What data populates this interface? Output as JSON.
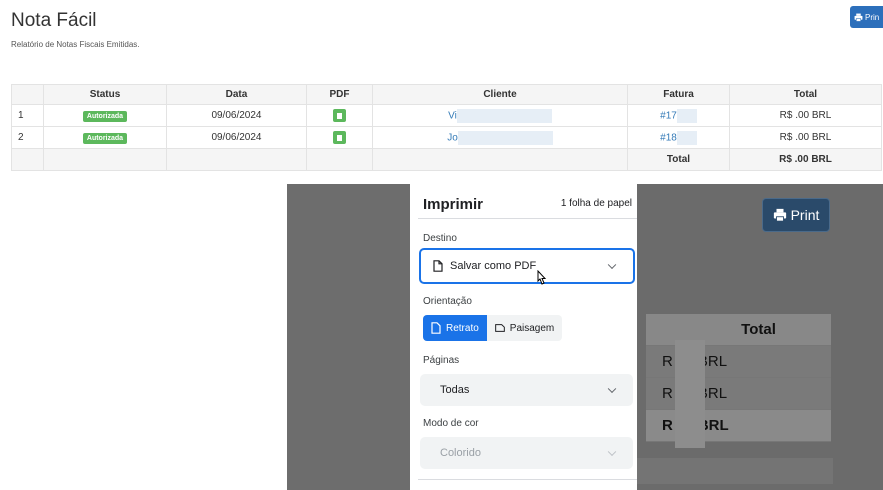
{
  "report": {
    "title": "Nota Fácil",
    "subtitle": "Relatório de Notas Fiscais Emitidas.",
    "print_button_label": "Prin",
    "columns": [
      "Status",
      "Data",
      "PDF",
      "Cliente",
      "Fatura",
      "Total"
    ],
    "rows": [
      {
        "index": "1",
        "status": "Autorizada",
        "date": "09/06/2024",
        "client": "Vi",
        "invoice": "#17",
        "total": "R$ .00 BRL"
      },
      {
        "index": "2",
        "status": "Autorizada",
        "date": "09/06/2024",
        "client": "Jo",
        "invoice": "#18",
        "total": "R$ .00 BRL"
      }
    ],
    "footer": {
      "label": "Total",
      "total": "R$ .00 BRL"
    }
  },
  "preview": {
    "print_button_label": "Print",
    "header": "Total",
    "row1": "R 00 BRL",
    "row2": "R 00 BRL",
    "total": "R 00 BRL"
  },
  "dialog": {
    "title": "Imprimir",
    "sheets": "1 folha de papel",
    "destination_label": "Destino",
    "destination_value": "Salvar como PDF",
    "orientation_label": "Orientação",
    "orientation_options": [
      "Retrato",
      "Paisagem"
    ],
    "orientation_selected": "Retrato",
    "pages_label": "Páginas",
    "pages_value": "Todas",
    "color_label": "Modo de cor",
    "color_value": "Colorido"
  },
  "colors": {
    "accent": "#1a73e8",
    "badge": "#5cb85c",
    "link": "#337ab7"
  }
}
